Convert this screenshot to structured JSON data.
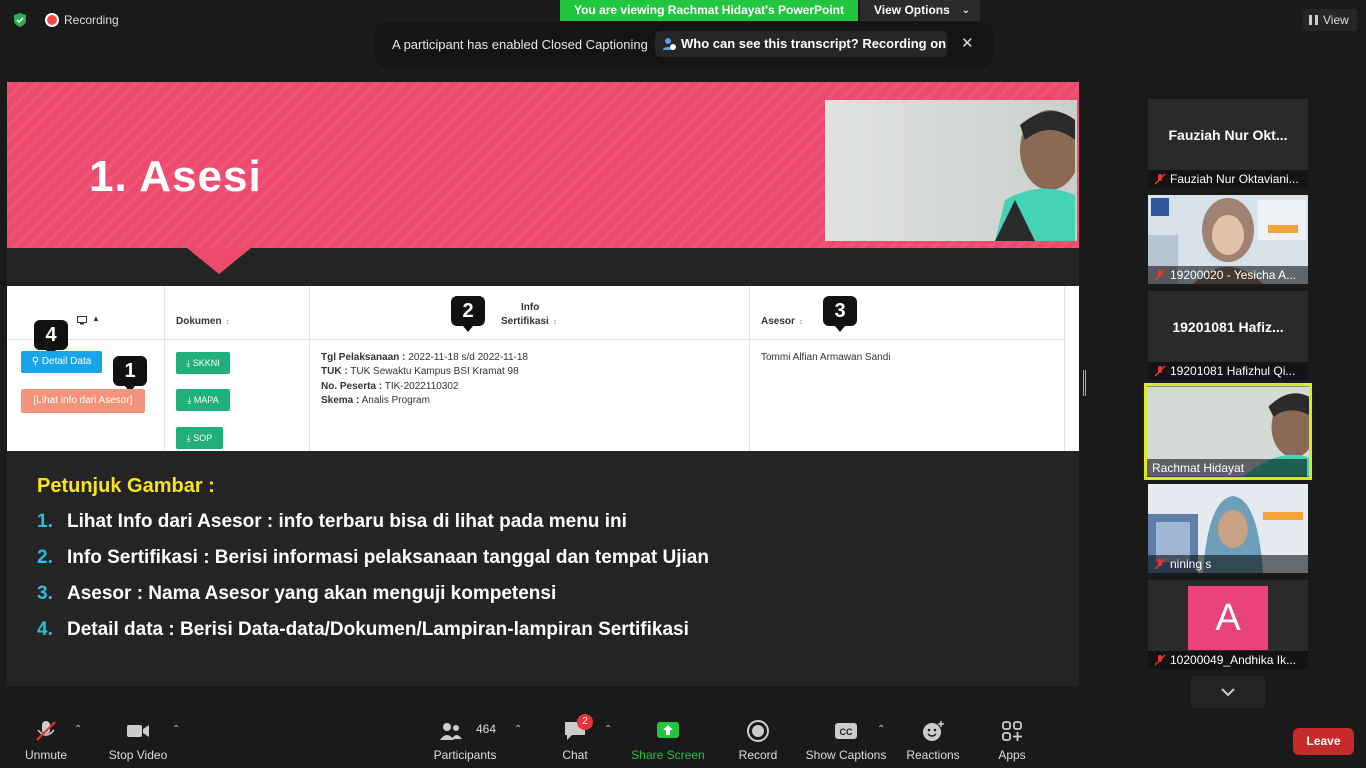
{
  "topbar": {
    "recording_label": "Recording",
    "viewing_banner": "You are viewing Rachmat Hidayat's PowerPoint",
    "view_options_label": "View Options",
    "view_label": "View"
  },
  "caption_banner": {
    "message": "A participant has enabled Closed Captioning",
    "who_can_see": "Who can see this transcript? Recording on",
    "close_glyph": "✕"
  },
  "slide": {
    "title": "1. Asesi",
    "table": {
      "headers": {
        "dokumen": "Dokumen",
        "info_line1": "Info",
        "info_line2": "Sertifikasi",
        "asesor": "Asesor"
      },
      "badges": [
        "1",
        "2",
        "3",
        "4"
      ],
      "detail_button": "Detail Data",
      "lihat_button": "[Lihat info dari Asesor]",
      "doc_buttons": [
        "SKKNI",
        "MAPA",
        "SOP"
      ],
      "info": [
        {
          "label": "Tgl Pelaksanaan :",
          "value": " 2022-11-18 s/d 2022-11-18"
        },
        {
          "label": "TUK :",
          "value": " TUK Sewaktu Kampus BSI Kramat 98"
        },
        {
          "label": "No. Peserta :",
          "value": " TIK-2022110302"
        },
        {
          "label": "Skema :",
          "value": " Analis Program"
        }
      ],
      "asesor_name": "Tommi Alfian Armawan Sandi"
    },
    "instructions": {
      "title": "Petunjuk Gambar :",
      "items": [
        {
          "num": "1.",
          "text": "Lihat Info dari Asesor : info terbaru bisa di lihat pada menu ini"
        },
        {
          "num": "2.",
          "text": "Info Sertifikasi : Berisi informasi pelaksanaan tanggal dan tempat Ujian"
        },
        {
          "num": "3.",
          "text": "Asesor : Nama Asesor yang akan menguji kompetensi"
        },
        {
          "num": "4.",
          "text": "Detail data : Berisi Data-data/Dokumen/Lampiran-lampiran Sertifikasi"
        }
      ]
    }
  },
  "gallery": {
    "tiles": [
      {
        "big_name": "Fauziah Nur Okt...",
        "footer": "Fauziah Nur Oktaviani..."
      },
      {
        "big_name": "",
        "footer": "19200020 - Yesicha A..."
      },
      {
        "big_name": "19201081 Hafiz...",
        "footer": "19201081 Hafizhul Qi..."
      },
      {
        "big_name": "",
        "footer": "Rachmat Hidayat"
      },
      {
        "big_name": "",
        "footer": "nining s"
      },
      {
        "big_name": "",
        "footer": "10200049_Andhika Ik...",
        "avatar_letter": "A"
      }
    ]
  },
  "toolbar": {
    "unmute": "Unmute",
    "stop_video": "Stop Video",
    "participants": "Participants",
    "participant_count": "464",
    "chat": "Chat",
    "chat_badge": "2",
    "share_screen": "Share Screen",
    "record": "Record",
    "show_captions": "Show Captions",
    "reactions": "Reactions",
    "apps": "Apps",
    "leave": "Leave"
  },
  "colors": {
    "accent_green": "#22c53f",
    "slide_banner": "#ee4a6e",
    "leave_red": "#c72a2a",
    "instruction_title": "#f7e51c",
    "instruction_number": "#2bc0d6"
  }
}
